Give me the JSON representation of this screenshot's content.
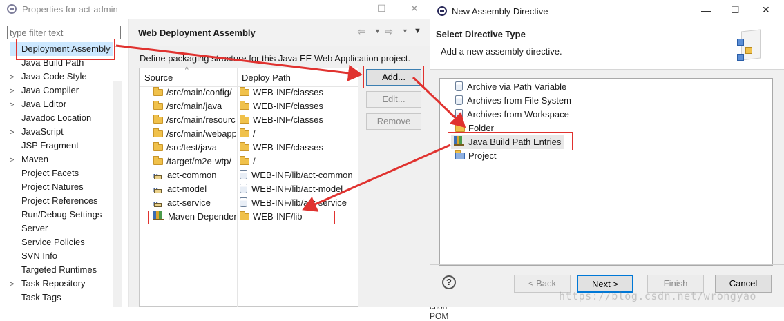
{
  "props_window": {
    "title": "Properties for act-admin",
    "filter_placeholder": "type filter text",
    "nav_items": [
      {
        "label": "Deployment Assembly",
        "twisty": ""
      },
      {
        "label": "Java Build Path",
        "twisty": ""
      },
      {
        "label": "Java Code Style",
        "twisty": ">"
      },
      {
        "label": "Java Compiler",
        "twisty": ">"
      },
      {
        "label": "Java Editor",
        "twisty": ">"
      },
      {
        "label": "Javadoc Location",
        "twisty": ""
      },
      {
        "label": "JavaScript",
        "twisty": ">"
      },
      {
        "label": "JSP Fragment",
        "twisty": ""
      },
      {
        "label": "Maven",
        "twisty": ">"
      },
      {
        "label": "Project Facets",
        "twisty": ""
      },
      {
        "label": "Project Natures",
        "twisty": ""
      },
      {
        "label": "Project References",
        "twisty": ""
      },
      {
        "label": "Run/Debug Settings",
        "twisty": ""
      },
      {
        "label": "Server",
        "twisty": ""
      },
      {
        "label": "Service Policies",
        "twisty": ""
      },
      {
        "label": "SVN Info",
        "twisty": ""
      },
      {
        "label": "Targeted Runtimes",
        "twisty": ""
      },
      {
        "label": "Task Repository",
        "twisty": ">"
      },
      {
        "label": "Task Tags",
        "twisty": ""
      }
    ],
    "page_title": "Web Deployment Assembly",
    "description": "Define packaging structure for this Java EE Web Application project.",
    "col_source": "Source",
    "col_deploy": "Deploy Path",
    "rows": [
      {
        "source": "/src/main/config/",
        "deploy": "WEB-INF/classes",
        "icon": "folder",
        "dicon": "folder"
      },
      {
        "source": "/src/main/java",
        "deploy": "WEB-INF/classes",
        "icon": "folder",
        "dicon": "folder"
      },
      {
        "source": "/src/main/resources",
        "deploy": "WEB-INF/classes",
        "icon": "folder",
        "dicon": "folder"
      },
      {
        "source": "/src/main/webapp",
        "deploy": "/",
        "icon": "folder",
        "dicon": "folder"
      },
      {
        "source": "/src/test/java",
        "deploy": "WEB-INF/classes",
        "icon": "folder",
        "dicon": "folder"
      },
      {
        "source": "/target/m2e-wtp/",
        "deploy": "/",
        "icon": "folder",
        "dicon": "folder"
      },
      {
        "source": "act-common",
        "deploy": "WEB-INF/lib/act-common",
        "icon": "project",
        "dicon": "jar"
      },
      {
        "source": "act-model",
        "deploy": "WEB-INF/lib/act-model",
        "icon": "project",
        "dicon": "jar"
      },
      {
        "source": "act-service",
        "deploy": "WEB-INF/lib/act-service",
        "icon": "project",
        "dicon": "jar"
      },
      {
        "source": "Maven Dependencies",
        "deploy": "WEB-INF/lib",
        "icon": "library",
        "dicon": "folder"
      }
    ],
    "buttons": {
      "add": "Add...",
      "edit": "Edit...",
      "remove": "Remove"
    }
  },
  "dialog": {
    "title": "New Assembly Directive",
    "heading": "Select Directive Type",
    "subheading": "Add a new assembly directive.",
    "options": [
      {
        "label": "Archive via Path Variable",
        "icon": "jar"
      },
      {
        "label": "Archives from File System",
        "icon": "jar"
      },
      {
        "label": "Archives from Workspace",
        "icon": "jar"
      },
      {
        "label": "Folder",
        "icon": "folder"
      },
      {
        "label": "Java Build Path Entries",
        "icon": "library"
      },
      {
        "label": "Project",
        "icon": "project-folder"
      }
    ],
    "buttons": {
      "help": "?",
      "back": "< Back",
      "next": "Next >",
      "finish": "Finish",
      "cancel": "Cancel"
    },
    "watermark": "https://blog.csdn.net/wrongyao",
    "window_controls": {
      "minimize": "—",
      "maximize": "☐",
      "close": "✕"
    }
  },
  "bg_text": "ction POM",
  "colors": {
    "highlight_red": "#e0322f",
    "selection": "#cce8ff",
    "accent": "#0078d7"
  }
}
